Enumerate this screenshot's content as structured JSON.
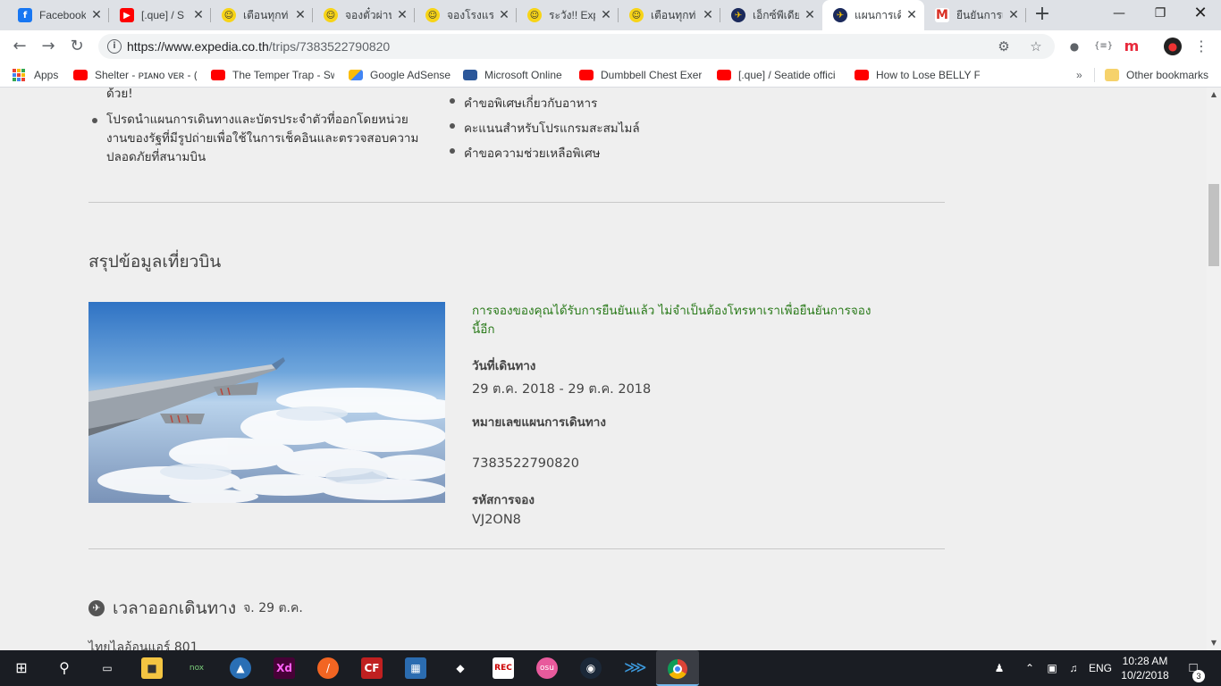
{
  "browser": {
    "tabs": [
      {
        "title": "Facebook",
        "icon": "facebook-icon",
        "fav": "f"
      },
      {
        "title": "[.que] / S",
        "icon": "youtube-icon",
        "fav": "▶"
      },
      {
        "title": "เตือนทุกท่",
        "icon": "emoji-icon",
        "fav": "☺"
      },
      {
        "title": "จองตั๋วผ่าน",
        "icon": "emoji-icon",
        "fav": "☺"
      },
      {
        "title": "จองโรงแรม",
        "icon": "emoji-icon",
        "fav": "☺"
      },
      {
        "title": "ระวัง!! Exp",
        "icon": "emoji-icon",
        "fav": "☺"
      },
      {
        "title": "เตือนทุกท่",
        "icon": "emoji-icon",
        "fav": "☺"
      },
      {
        "title": "เอ็กซ์พีเดีย",
        "icon": "expedia-icon",
        "fav": "✈"
      },
      {
        "title": "แผนการเดิ",
        "icon": "expedia-icon",
        "fav": "✈"
      },
      {
        "title": "ยืนยันการเ",
        "icon": "gmail-icon",
        "fav": "M"
      }
    ],
    "url_host": "https://www.expedia.co.th",
    "url_path": "/trips/7383522790820",
    "bookmarks": [
      {
        "label": "Apps",
        "icon": "apps"
      },
      {
        "label": "Shelter - ᴘɪᴀɴᴏ ᴠᴇʀ - (",
        "icon": "yt"
      },
      {
        "label": "The Temper Trap - Sw",
        "icon": "yt"
      },
      {
        "label": "Google AdSense",
        "icon": "ads"
      },
      {
        "label": "Microsoft Online",
        "icon": "word"
      },
      {
        "label": "Dumbbell Chest Exer",
        "icon": "yt"
      },
      {
        "label": "[.que] / Seatide offici",
        "icon": "yt"
      },
      {
        "label": "How to Lose BELLY F",
        "icon": "yt"
      }
    ],
    "other_bookmarks": "Other bookmarks",
    "more_bookmarks": "»"
  },
  "page": {
    "left_list_partial": "ด้วย!",
    "left_list": [
      "โปรดนำแผนการเดินทางและบัตรประจำตัวที่ออกโดยหน่วยงานของรัฐที่มีรูปถ่ายเพื่อใช้ในการเช็คอินและตรวจสอบความปลอดภัยที่สนามบิน"
    ],
    "right_list": [
      "คำขอพิเศษเกี่ยวกับอาหาร",
      "คะแนนสำหรับโปรแกรมสะสมไมล์",
      "คำขอความช่วยเหลือพิเศษ"
    ],
    "summary_title": "สรุปข้อมูลเที่ยวบิน",
    "confirmation_message": "การจองของคุณได้รับการยืนยันแล้ว ไม่จำเป็นต้องโทรหาเราเพื่อยืนยันการจองนี้อีก",
    "travel_dates_label": "วันที่เดินทาง",
    "travel_dates_value": "29 ต.ค. 2018 - 29 ต.ค. 2018",
    "itinerary_label": "หมายเลขแผนการเดินทาง",
    "itinerary_value": "7383522790820",
    "booking_code_label": "รหัสการจอง",
    "booking_code_value": "VJ2ON8",
    "departure_heading": "เวลาออกเดินทาง",
    "departure_date": "จ. 29 ต.ค.",
    "airline": "ไทยไลอ้อนแอร์ 801"
  },
  "taskbar": {
    "language": "ENG",
    "time": "10:28 AM",
    "date": "10/2/2018",
    "notifications": "3"
  }
}
